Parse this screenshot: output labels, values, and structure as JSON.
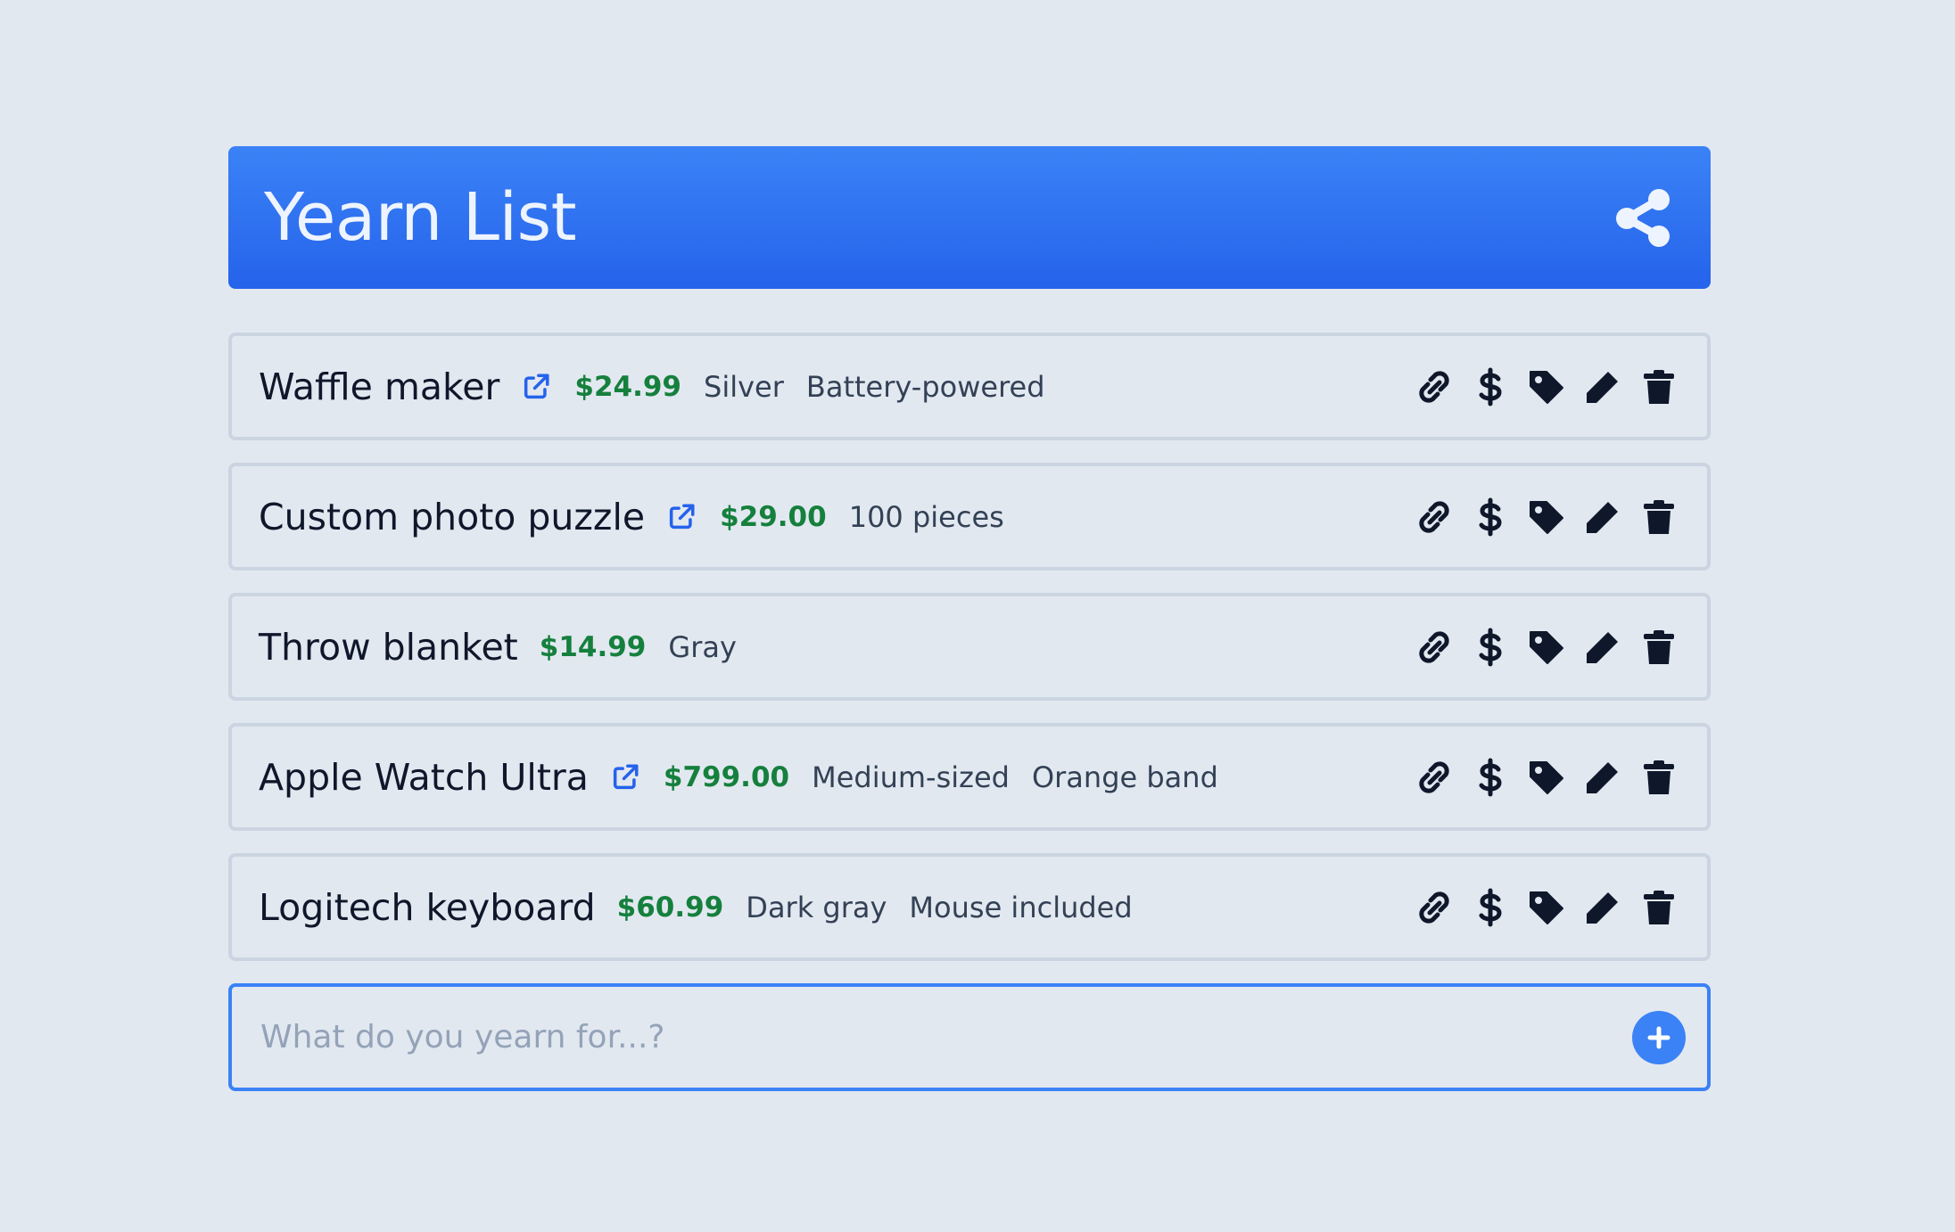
{
  "app": {
    "title": "Yearn List"
  },
  "header": {
    "share_icon": "share-icon"
  },
  "items": [
    {
      "name": "Waffle maker",
      "has_link": true,
      "price": "$24.99",
      "tags": [
        "Silver",
        "Battery-powered"
      ]
    },
    {
      "name": "Custom photo puzzle",
      "has_link": true,
      "price": "$29.00",
      "tags": [
        "100 pieces"
      ]
    },
    {
      "name": "Throw blanket",
      "has_link": false,
      "price": "$14.99",
      "tags": [
        "Gray"
      ]
    },
    {
      "name": "Apple Watch Ultra",
      "has_link": true,
      "price": "$799.00",
      "tags": [
        "Medium-sized",
        "Orange band"
      ]
    },
    {
      "name": "Logitech keyboard",
      "has_link": false,
      "price": "$60.99",
      "tags": [
        "Dark gray",
        "Mouse included"
      ]
    }
  ],
  "item_actions": [
    "link-icon",
    "dollar-icon",
    "tag-icon",
    "pencil-icon",
    "trash-icon"
  ],
  "new_item": {
    "placeholder": "What do you yearn for...?",
    "add_icon": "plus-icon"
  },
  "colors": {
    "background": "#e2e8f0",
    "header_top": "#3b82f6",
    "header_bottom": "#2563eb",
    "header_text": "#eef4ff",
    "item_border": "#cbd5e1",
    "input_border": "#3b82f6",
    "price": "#15803d",
    "external_link": "#2563eb",
    "icon": "#0f172a",
    "add_button": "#3b82f6"
  }
}
